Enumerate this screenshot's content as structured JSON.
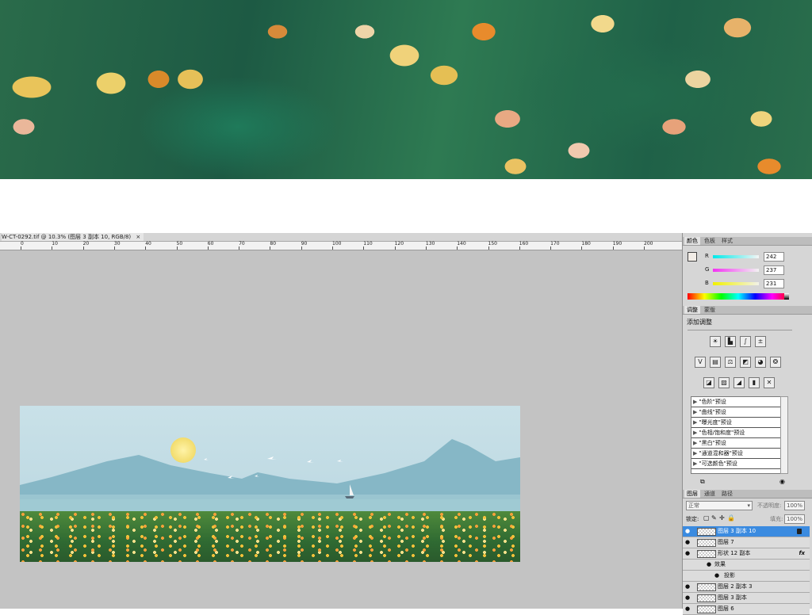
{
  "document": {
    "tab_title": "W-CT-0292.tif @ 10.3% (图层 3 副本 10, RGB/8)",
    "close": "×"
  },
  "ruler": {
    "labels": [
      "0",
      "10",
      "20",
      "30",
      "40",
      "50",
      "60",
      "70",
      "80",
      "90",
      "100",
      "110",
      "120",
      "130",
      "140",
      "150",
      "160",
      "170",
      "180",
      "190",
      "200"
    ]
  },
  "color_panel": {
    "tabs": [
      "颜色",
      "色板",
      "样式"
    ],
    "r_label": "R",
    "r_value": "242",
    "g_label": "G",
    "g_value": "237",
    "b_label": "B",
    "b_value": "231"
  },
  "adjustments_panel": {
    "tabs": [
      "调整",
      "蒙版"
    ],
    "title": "添加调整",
    "icons": [
      "brightness-icon",
      "levels-icon",
      "curves-icon",
      "exposure-icon",
      "vibrance-icon",
      "hue-saturation-icon",
      "color-balance-icon",
      "black-white-icon",
      "photo-filter-icon",
      "channel-mixer-icon",
      "invert-icon",
      "posterize-icon",
      "threshold-icon",
      "gradient-map-icon",
      "selective-color-icon"
    ],
    "presets": [
      "\"色阶\"预设",
      "\"曲线\"预设",
      "\"曝光度\"预设",
      "\"色相/饱和度\"预设",
      "\"黑白\"预设",
      "\"通道混和器\"预设",
      "\"可选颜色\"预设"
    ]
  },
  "layers_panel": {
    "tabs": [
      "图层",
      "通道",
      "路径"
    ],
    "blend_mode": "正常",
    "opacity_label": "不透明度:",
    "opacity_value": "100%",
    "lock_label": "锁定:",
    "fill_label": "填充:",
    "fill_value": "100%",
    "fx_label": "fx",
    "layers": [
      {
        "name": "图层 3 副本 10",
        "selected": true,
        "locked": true
      },
      {
        "name": "图层 7"
      },
      {
        "name": "形状 12 副本",
        "fx": true
      },
      {
        "name": "效果",
        "sub": true
      },
      {
        "name": "投影",
        "sub2": true
      },
      {
        "name": "图层 2 副本 3"
      },
      {
        "name": "图层 3 副本"
      },
      {
        "name": "图层 6"
      }
    ]
  }
}
